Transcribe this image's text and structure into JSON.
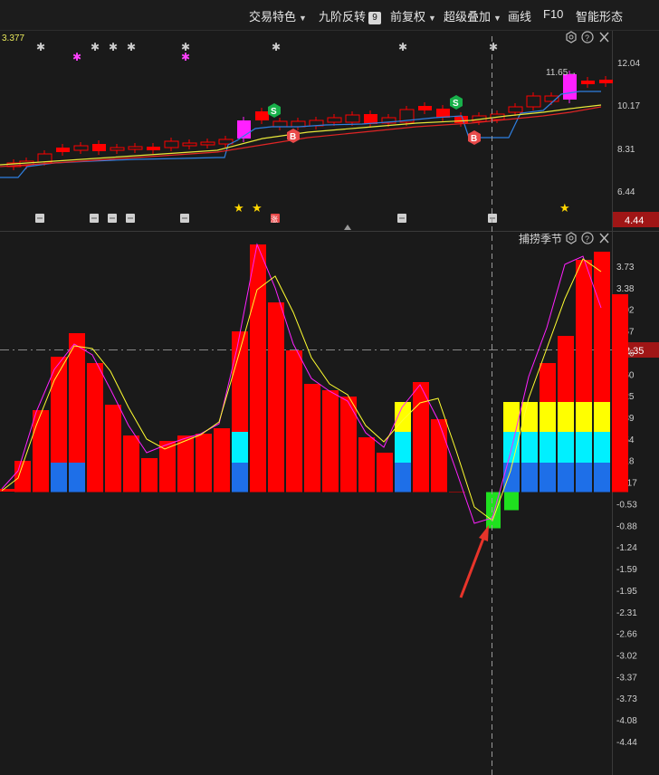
{
  "toolbar": {
    "trade_features": "交易特色",
    "nine_reversal": "九阶反转",
    "nine_badge": "9",
    "pre_adjust": "前复权",
    "super_overlay": "超级叠加",
    "draw_line": "画线",
    "f10": "F10",
    "smart_pattern": "智能形态"
  },
  "price_panel": {
    "last_value": "3.377",
    "high_price_label": "11.65→",
    "price_ticks": [
      "12.04",
      "10.17",
      "8.31",
      "6.44"
    ],
    "crosshair_price": "4.44",
    "signal_s": "S",
    "signal_b": "B",
    "event_tag": "涨"
  },
  "indicator_panel": {
    "title": "捕捞季节",
    "crosshair_value": "2.35",
    "ticks": [
      "3.73",
      "3.38",
      "3.02",
      "2.67",
      "1.96",
      "1.60",
      "1.25",
      "0.89",
      "0.54",
      "0.18",
      "-0.17",
      "-0.53",
      "-0.88",
      "-1.24",
      "-1.59",
      "-1.95",
      "-2.31",
      "-2.66",
      "-3.02",
      "-3.37",
      "-3.73",
      "-4.08",
      "-4.44"
    ]
  },
  "colors": {
    "background": "#1a1a1a",
    "bar_red": "#ff0000",
    "bar_green": "#1fe01f",
    "bar_blue": "#1e6fe8",
    "bar_cyan": "#00f0ff",
    "bar_yellow": "#ffff00",
    "magenta": "#ff20ff",
    "ma_yellow": "#e8e83a",
    "ma_blue": "#2f7fe0",
    "ma_red": "#e02525",
    "arrow": "#e8342a",
    "crosshair_badge": "#a01616"
  }
}
